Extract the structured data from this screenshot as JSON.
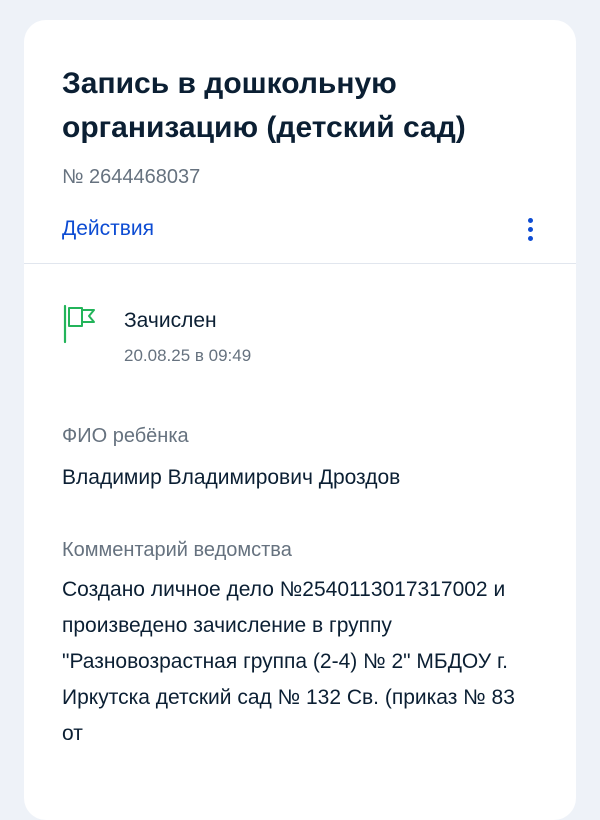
{
  "application": {
    "title": "Запись в дошкольную организацию (детский сад)",
    "number": "№ 2644468037",
    "actions_label": "Действия",
    "more_icon": "kebab-menu-icon"
  },
  "status": {
    "icon": "flag-icon",
    "icon_color": "#23b45a",
    "title": "Зачислен",
    "date": "20.08.25 в 09:49"
  },
  "child": {
    "label": "ФИО ребёнка",
    "value": "Владимир Владимирович Дроздов"
  },
  "comment": {
    "label": "Комментарий ведомства",
    "value": "Создано личное дело №2540113017317002 и произведено зачисление в группу \"Разновозрастная группа (2-4) № 2\" МБДОУ г. Иркутска детский сад № 132 Св. (приказ № 83 от"
  },
  "colors": {
    "accent": "#0d4cd3",
    "background": "#eef2f8",
    "secondary_text": "#66727f"
  }
}
